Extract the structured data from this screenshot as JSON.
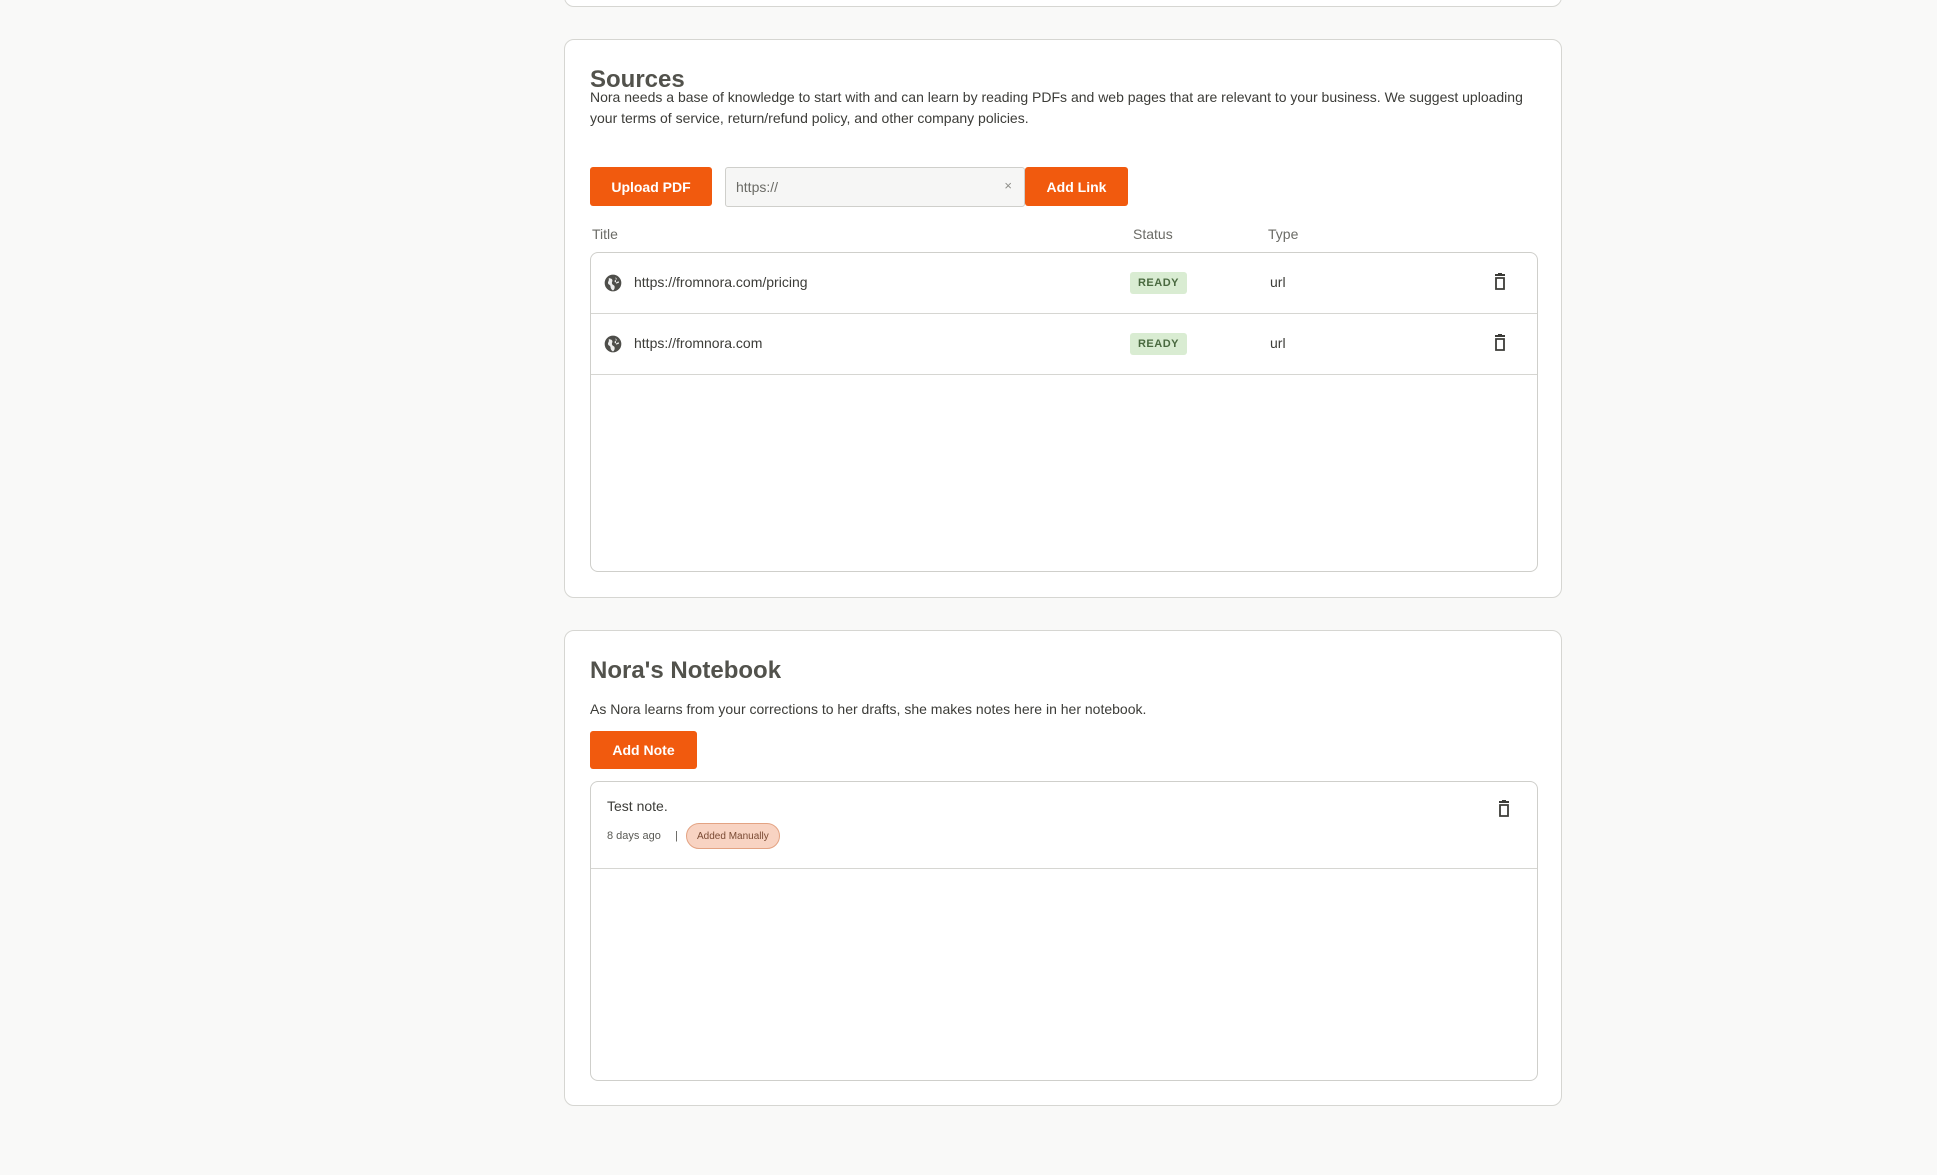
{
  "sources": {
    "title": "Sources",
    "description": "Nora needs a base of knowledge to start with and can learn by reading PDFs and web pages that are relevant to your business. We suggest uploading your terms of service, return/refund policy, and other company policies.",
    "upload_pdf_label": "Upload PDF",
    "url_input_value": "",
    "url_input_placeholder": "https://",
    "clear_symbol": "×",
    "add_link_label": "Add Link",
    "columns": {
      "title": "Title",
      "status": "Status",
      "type": "Type"
    },
    "rows": [
      {
        "title": "https://fromnora.com/pricing",
        "status": "READY",
        "type": "url",
        "icon": "globe-icon"
      },
      {
        "title": "https://fromnora.com",
        "status": "READY",
        "type": "url",
        "icon": "globe-icon"
      }
    ]
  },
  "notebook": {
    "title": "Nora's Notebook",
    "description": "As Nora learns from your corrections to her drafts, she makes notes here in her notebook.",
    "add_note_label": "Add Note",
    "notes": [
      {
        "text": "Test note.",
        "age": "8 days ago",
        "separator": "|",
        "badge": "Added Manually"
      }
    ]
  },
  "colors": {
    "accent": "#f15a0e",
    "ready_badge_bg": "#d9ecd2",
    "manual_badge_bg": "#f8d3c2",
    "page_bg": "#f9f9f8"
  }
}
